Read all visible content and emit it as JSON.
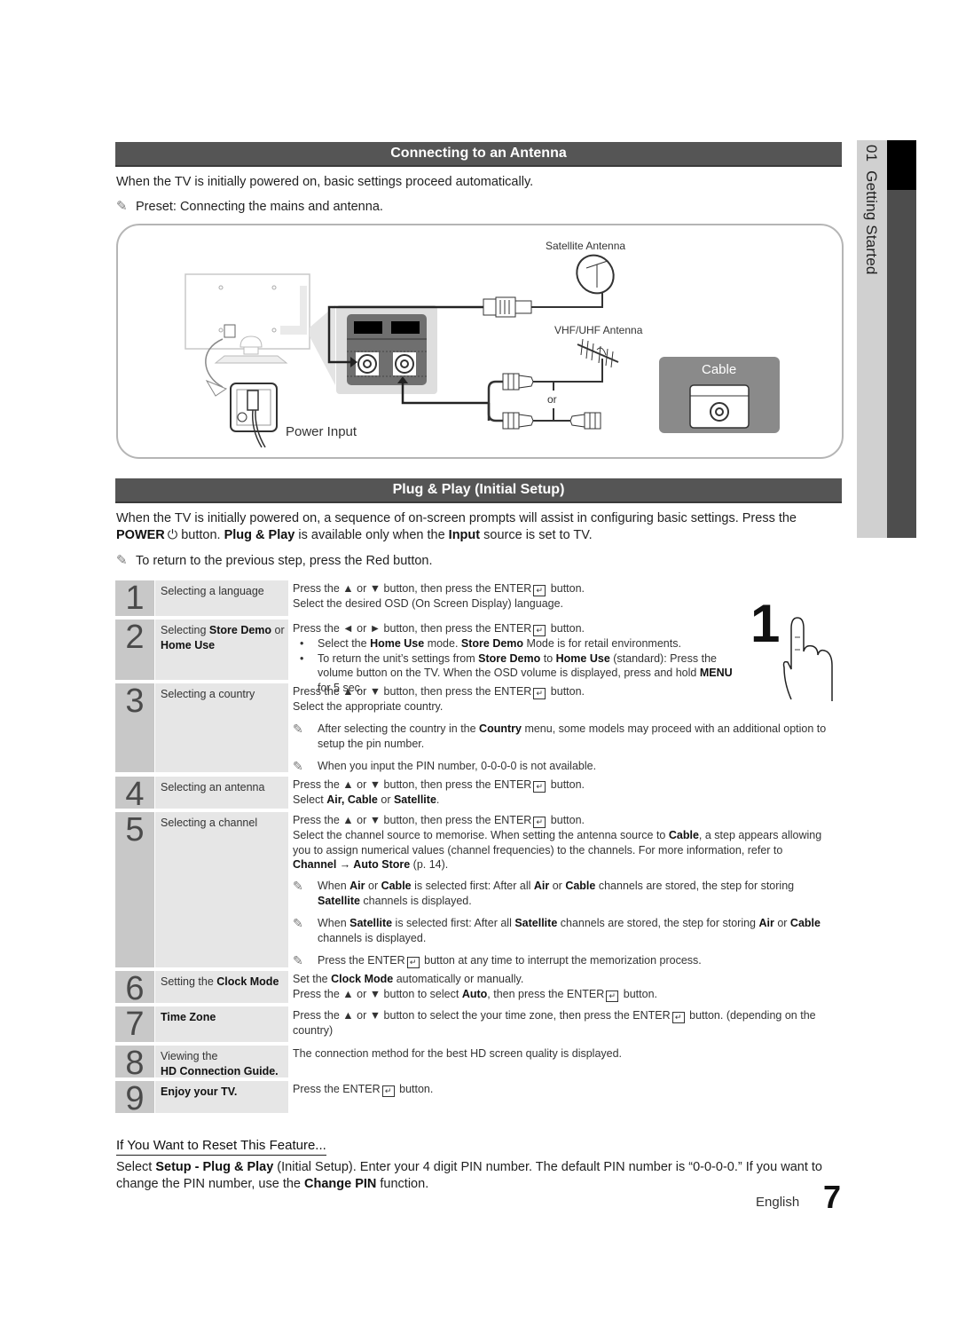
{
  "side_tab": {
    "chapter": "01",
    "title": "Getting Started"
  },
  "antenna_section": {
    "title": "Connecting to an Antenna",
    "intro": "When the TV is initially powered on, basic settings proceed automatically.",
    "note": "Preset: Connecting the mains and antenna.",
    "diagram": {
      "satellite_label": "Satellite Antenna",
      "vhf_label": "VHF/UHF Antenna",
      "or_label": "or",
      "cable_label": "Cable",
      "power_label": "Power Input"
    }
  },
  "plug_play_section": {
    "title": "Plug & Play (Initial Setup)",
    "intro_1": "When the TV is initially powered on, a sequence of on-screen prompts will assist in configuring basic settings. Press the",
    "intro_power": "POWER",
    "intro_2a": " button. ",
    "intro_plug": "Plug & Play",
    "intro_2b": " is available only when the ",
    "intro_input": "Input",
    "intro_2c": " source is set to TV.",
    "note": "To return to the previous step, press the Red button.",
    "hand_number": "1"
  },
  "steps": [
    {
      "num": "1",
      "title": "Selecting a language",
      "line1": "Press the ▲ or ▼ button, then press the ENTER",
      "line1_end": " button.",
      "line2": "Select the desired OSD (On Screen Display) language."
    },
    {
      "num": "2",
      "title_a": "Selecting ",
      "title_b": "Store Demo",
      "title_c": " or",
      "title_d": "Home Use",
      "line1": "Press the ◄ or ► button, then press the ENTER",
      "line1_end": " button.",
      "bullet1": [
        "Select the ",
        "Home Use",
        " mode. ",
        "Store Demo",
        " Mode is for retail environments."
      ],
      "bullet2": [
        "To return the unit’s settings from ",
        "Store Demo",
        " to ",
        "Home Use",
        " (standard): Press the volume button on the TV. When the OSD volume is displayed, press and hold ",
        "MENU",
        " for 5 sec."
      ]
    },
    {
      "num": "3",
      "title": "Selecting a country",
      "line1": "Press the ▲ or ▼ button, then press the ENTER",
      "line1_end": " button.",
      "line2": "Select the appropriate country.",
      "note1": [
        "After selecting the country in the ",
        "Country",
        " menu, some models may proceed with an additional option to setup the pin number."
      ],
      "note2": "When you input the PIN number, 0-0-0-0 is not available."
    },
    {
      "num": "4",
      "title": "Selecting an antenna",
      "line1": "Press the ▲ or ▼ button, then press the ENTER",
      "line1_end": " button.",
      "line2": [
        "Select ",
        "Air, Cable",
        " or ",
        "Satellite",
        "."
      ]
    },
    {
      "num": "5",
      "title": "Selecting a channel",
      "line1": "Press the ▲ or ▼ button, then press the ENTER",
      "line1_end": " button.",
      "line2": [
        "Select the channel source to memorise. When setting the antenna source to ",
        "Cable",
        ", a step appears allowing you to assign numerical values (channel frequencies) to the channels. For more information, refer to ",
        "Channel → Auto Store",
        " (p. 14)."
      ],
      "note1": [
        "When ",
        "Air",
        " or ",
        "Cable",
        " is selected first: After all ",
        "Air",
        " or ",
        "Cable",
        " channels are stored, the step for storing ",
        "Satellite",
        " channels is displayed."
      ],
      "note2": [
        "When ",
        "Satellite",
        " is selected first: After all ",
        "Satellite",
        " channels are stored, the step for storing ",
        "Air",
        " or ",
        "Cable",
        " channels is displayed."
      ],
      "note3": [
        "Press the ENTER",
        " button at any time to interrupt the memorization process."
      ]
    },
    {
      "num": "6",
      "title_a": "Setting the ",
      "title_b": "Clock Mode",
      "line1": [
        "Set the ",
        "Clock Mode",
        " automatically or manually."
      ],
      "line2": [
        "Press the ▲ or ▼ button to select ",
        "Auto",
        ", then press the ENTER",
        " button."
      ]
    },
    {
      "num": "7",
      "title": "Time Zone",
      "line1": "Press the ▲ or ▼ button to select the your time zone, then press the ENTER",
      "line1_end": " button. (depending on the country)"
    },
    {
      "num": "8",
      "title_a": "Viewing the",
      "title_b": "HD Connection Guide.",
      "line1": "The connection method for the best HD screen quality is displayed."
    },
    {
      "num": "9",
      "title": "Enjoy your TV.",
      "line1": "Press the ENTER",
      "line1_end": " button."
    }
  ],
  "reset": {
    "title": "If You Want to Reset This Feature...",
    "text": [
      "Select ",
      "Setup - Plug & Play",
      " (Initial Setup). Enter your 4 digit PIN number. The default PIN number is “0-0-0-0.” If you want to change the PIN number, use the ",
      "Change PIN",
      " function."
    ]
  },
  "footer": {
    "language": "English",
    "page": "7"
  },
  "colors": {
    "section_bar": "#555555",
    "step_num_bg": "#c8c8c8",
    "step_title_bg": "#e6e6e6",
    "side_dark": "#4d4d4d",
    "cable_box": "#8a8a8a"
  }
}
